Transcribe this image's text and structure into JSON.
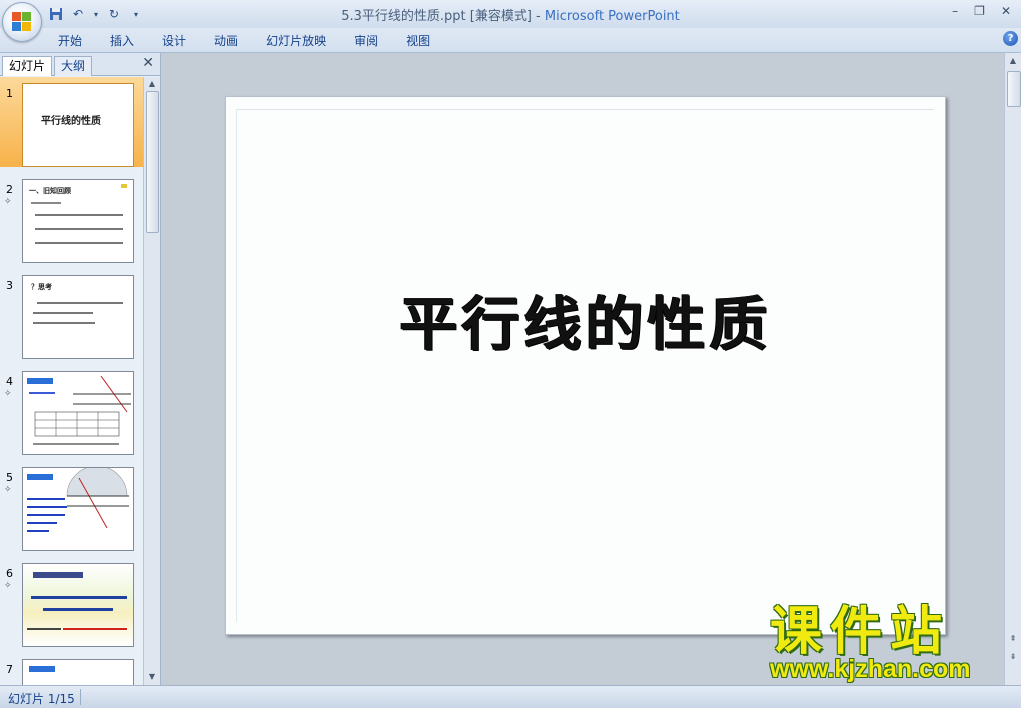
{
  "titlebar": {
    "doc_title": "5.3平行线的性质.ppt [兼容模式]",
    "separator": " - ",
    "app_name": "Microsoft PowerPoint"
  },
  "qat": {
    "save_icon": "save-icon",
    "undo_icon": "undo-icon",
    "redo_icon": "redo-icon",
    "customize_icon": "chevron-down-icon"
  },
  "ribbon": {
    "tabs": [
      "开始",
      "插入",
      "设计",
      "动画",
      "幻灯片放映",
      "审阅",
      "视图"
    ],
    "help": "?"
  },
  "left_pane": {
    "tab_slides": "幻灯片",
    "tab_outline": "大纲",
    "close": "✕",
    "slides": [
      {
        "num": "1",
        "title": "平行线的性质"
      },
      {
        "num": "2",
        "title": "一、旧知回顾"
      },
      {
        "num": "3",
        "title": "？思考"
      },
      {
        "num": "4",
        "title": ""
      },
      {
        "num": "5",
        "title": ""
      },
      {
        "num": "6",
        "title": ""
      },
      {
        "num": "7",
        "title": ""
      }
    ]
  },
  "main_slide": {
    "title": "平行线的性质"
  },
  "watermark": {
    "top": "课件站",
    "bottom": "www.kjzhan.com"
  },
  "status": {
    "slide_counter": "幻灯片 1/15"
  }
}
